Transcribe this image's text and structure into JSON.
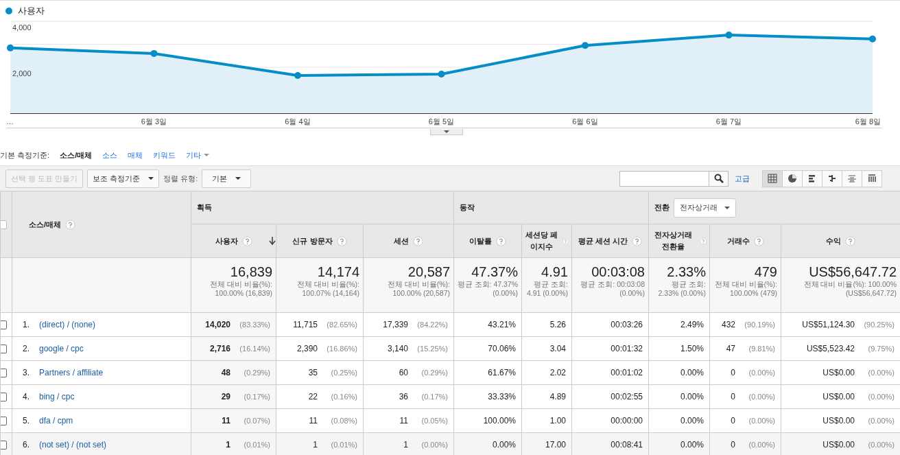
{
  "chart": {
    "chart_data": {
      "type": "area",
      "categories": [
        "…",
        "6월 3일",
        "6월 4일",
        "6월 5일",
        "6월 6일",
        "6월 7일",
        "6월 8일"
      ],
      "series": [
        {
          "name": "사용자",
          "color": "#058dc7",
          "values": [
            2840,
            2600,
            1640,
            1700,
            2950,
            3400,
            3230
          ]
        }
      ],
      "ylim": [
        0,
        4000
      ],
      "yticks": [
        {
          "value": 2000,
          "label": "2,000"
        },
        {
          "value": 4000,
          "label": "4,000"
        }
      ]
    }
  },
  "dimension_bar": {
    "label": "기본 측정기준:",
    "options": [
      {
        "label": "소스/매체",
        "selected": true
      },
      {
        "label": "소스",
        "selected": false
      },
      {
        "label": "매체",
        "selected": false
      },
      {
        "label": "키워드",
        "selected": false
      }
    ],
    "more": "기타"
  },
  "toolbar": {
    "plot_rows": {
      "label": "선택 행 도표 만들기",
      "disabled": true
    },
    "secondary_dimension": "보조 측정기준",
    "sort_label": "정렬 유형:",
    "sort_value": "기본",
    "advanced": "고급",
    "views": [
      {
        "kind": "table",
        "selected": true
      },
      {
        "kind": "pie",
        "selected": false
      },
      {
        "kind": "bars",
        "selected": false
      },
      {
        "kind": "compare",
        "selected": false
      },
      {
        "kind": "pivot",
        "selected": false
      },
      {
        "kind": "columns",
        "selected": false
      }
    ]
  },
  "table": {
    "dimension_header": "소스/매체",
    "all_checked": false,
    "groups": [
      {
        "label": "획득"
      },
      {
        "label": "동작"
      },
      {
        "label": "전환",
        "dropdown": "전자상거래"
      }
    ],
    "columns": [
      {
        "label": "사용자",
        "sorted": true
      },
      {
        "label": "신규 방문자",
        "sorted": false
      },
      {
        "label": "세션",
        "sorted": false
      },
      {
        "label": "이탈률",
        "sorted": false
      },
      {
        "label": "세션당 페이지수",
        "sorted": false
      },
      {
        "label": "평균 세션 시간",
        "sorted": false
      },
      {
        "label": "전자상거래 전환율",
        "sorted": false
      },
      {
        "label": "거래수",
        "sorted": false
      },
      {
        "label": "수익",
        "sorted": false
      }
    ],
    "totals": [
      {
        "value": "16,839",
        "note": "전체 대비 비율(%): 100.00% (16,839)"
      },
      {
        "value": "14,174",
        "note": "전체 대비 비율(%): 100.07% (14,164)"
      },
      {
        "value": "20,587",
        "note": "전체 대비 비율(%): 100.00% (20,587)"
      },
      {
        "value": "47.37%",
        "note": "평균 조회: 47.37% (0.00%)"
      },
      {
        "value": "4.91",
        "note": "평균 조회: 4.91 (0.00%)"
      },
      {
        "value": "00:03:08",
        "note": "평균 조회: 00:03:08 (0.00%)"
      },
      {
        "value": "2.33%",
        "note": "평균 조회: 2.33% (0.00%)"
      },
      {
        "value": "479",
        "note": "전체 대비 비율(%): 100.00% (479)"
      },
      {
        "value": "US$56,647.72",
        "note": "전체 대비 비율(%): 100.00% (US$56,647.72)"
      }
    ],
    "rows": [
      {
        "index": "1.",
        "source": "(direct) / (none)",
        "checked": false,
        "cells": [
          {
            "value": "14,020",
            "share": "(83.33%)"
          },
          {
            "value": "11,715",
            "share": "(82.65%)"
          },
          {
            "value": "17,339",
            "share": "(84.22%)"
          },
          {
            "value": "43.21%"
          },
          {
            "value": "5.26"
          },
          {
            "value": "00:03:26"
          },
          {
            "value": "2.49%"
          },
          {
            "value": "432",
            "share": "(90.19%)"
          },
          {
            "value": "US$51,124.30",
            "share": "(90.25%)"
          }
        ]
      },
      {
        "index": "2.",
        "source": "google / cpc",
        "checked": false,
        "cells": [
          {
            "value": "2,716",
            "share": "(16.14%)"
          },
          {
            "value": "2,390",
            "share": "(16.86%)"
          },
          {
            "value": "3,140",
            "share": "(15.25%)"
          },
          {
            "value": "70.06%"
          },
          {
            "value": "3.04"
          },
          {
            "value": "00:01:32"
          },
          {
            "value": "1.50%"
          },
          {
            "value": "47",
            "share": "(9.81%)"
          },
          {
            "value": "US$5,523.42",
            "share": "(9.75%)"
          }
        ]
      },
      {
        "index": "3.",
        "source": "Partners / affiliate",
        "checked": false,
        "cells": [
          {
            "value": "48",
            "share": "(0.29%)"
          },
          {
            "value": "35",
            "share": "(0.25%)"
          },
          {
            "value": "60",
            "share": "(0.29%)"
          },
          {
            "value": "61.67%"
          },
          {
            "value": "2.02"
          },
          {
            "value": "00:01:02"
          },
          {
            "value": "0.00%"
          },
          {
            "value": "0",
            "share": "(0.00%)"
          },
          {
            "value": "US$0.00",
            "share": "(0.00%)"
          }
        ]
      },
      {
        "index": "4.",
        "source": "bing / cpc",
        "checked": false,
        "cells": [
          {
            "value": "29",
            "share": "(0.17%)"
          },
          {
            "value": "22",
            "share": "(0.16%)"
          },
          {
            "value": "36",
            "share": "(0.17%)"
          },
          {
            "value": "33.33%"
          },
          {
            "value": "4.89"
          },
          {
            "value": "00:02:55"
          },
          {
            "value": "0.00%"
          },
          {
            "value": "0",
            "share": "(0.00%)"
          },
          {
            "value": "US$0.00",
            "share": "(0.00%)"
          }
        ]
      },
      {
        "index": "5.",
        "source": "dfa / cpm",
        "checked": false,
        "cells": [
          {
            "value": "11",
            "share": "(0.07%)"
          },
          {
            "value": "11",
            "share": "(0.08%)"
          },
          {
            "value": "11",
            "share": "(0.05%)"
          },
          {
            "value": "100.00%"
          },
          {
            "value": "1.00"
          },
          {
            "value": "00:00:00"
          },
          {
            "value": "0.00%"
          },
          {
            "value": "0",
            "share": "(0.00%)"
          },
          {
            "value": "US$0.00",
            "share": "(0.00%)"
          }
        ]
      },
      {
        "index": "6.",
        "source": "(not set) / (not set)",
        "checked": false,
        "cells": [
          {
            "value": "1",
            "share": "(0.01%)"
          },
          {
            "value": "1",
            "share": "(0.01%)"
          },
          {
            "value": "1",
            "share": "(0.00%)"
          },
          {
            "value": "0.00%"
          },
          {
            "value": "17.00"
          },
          {
            "value": "00:08:41"
          },
          {
            "value": "0.00%"
          },
          {
            "value": "0",
            "share": "(0.00%)"
          },
          {
            "value": "US$0.00",
            "share": "(0.00%)"
          }
        ]
      }
    ]
  }
}
